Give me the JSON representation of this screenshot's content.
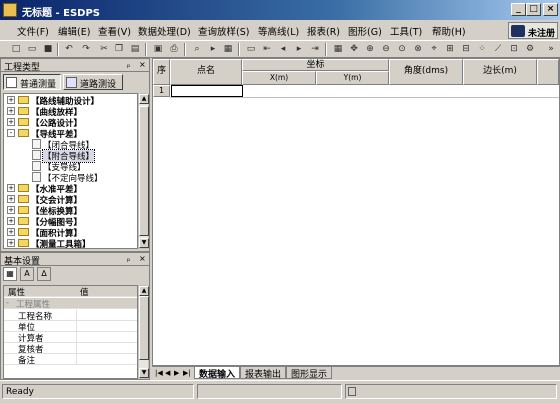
{
  "window": {
    "title": "无标题 - ESDPS"
  },
  "menu": {
    "items": [
      "文件(F)",
      "编辑(E)",
      "查看(V)",
      "数据处理(D)",
      "查询放样(S)",
      "等高线(L)",
      "报表(R)",
      "图形(G)",
      "工具(T)",
      "帮助(H)"
    ]
  },
  "registration": {
    "label": "未注册"
  },
  "left_panel": {
    "title": "工程类型",
    "pin": "ₚ",
    "close": "×",
    "tabs": [
      "普通测量",
      "道路测设"
    ],
    "tree": [
      {
        "level": 0,
        "type": "folder",
        "expander": "+",
        "label": "【路线辅助设计】"
      },
      {
        "level": 0,
        "type": "folder",
        "expander": "+",
        "label": "【曲线放样】"
      },
      {
        "level": 0,
        "type": "folder",
        "expander": "+",
        "label": "【公路设计】"
      },
      {
        "level": 0,
        "type": "folder",
        "expander": "-",
        "label": "【导线平差】"
      },
      {
        "level": 1,
        "type": "doc",
        "label": "【闭合导线】"
      },
      {
        "level": 1,
        "type": "doc",
        "label": "【附合导线】",
        "selected": true
      },
      {
        "level": 1,
        "type": "doc",
        "label": "【支导线】"
      },
      {
        "level": 1,
        "type": "doc",
        "label": "【不定向导线】"
      },
      {
        "level": 0,
        "type": "folder",
        "expander": "+",
        "label": "【水准平差】"
      },
      {
        "level": 0,
        "type": "folder",
        "expander": "+",
        "label": "【交会计算】"
      },
      {
        "level": 0,
        "type": "folder",
        "expander": "+",
        "label": "【坐标换算】"
      },
      {
        "level": 0,
        "type": "folder",
        "expander": "+",
        "label": "【分幅图号】"
      },
      {
        "level": 0,
        "type": "folder",
        "expander": "+",
        "label": "【面积计算】"
      },
      {
        "level": 0,
        "type": "folder",
        "expander": "+",
        "label": "【测量工具箱】"
      }
    ]
  },
  "settings_panel": {
    "title": "基本设置",
    "pin": "ₚ",
    "close": "×",
    "columns": [
      "属性",
      "值"
    ],
    "group": "工程属性",
    "group_expander": "-",
    "rows": [
      "工程名称",
      "单位",
      "计算者",
      "复核者",
      "备注"
    ]
  },
  "grid": {
    "headers": {
      "seq": "序",
      "name": "点名",
      "coord": "坐标",
      "x": "X(m)",
      "y": "Y(m)",
      "angle": "角度(dms)",
      "edge": "边长(m)"
    },
    "rows": [
      {
        "num": "1"
      }
    ]
  },
  "sheet_tabs": {
    "nav": [
      "|◀",
      "◀",
      "▶",
      "▶|"
    ],
    "tabs": [
      "数据输入",
      "报表输出",
      "图形显示"
    ],
    "active": 0
  },
  "status": {
    "text": "Ready"
  },
  "colors": {
    "title_start": "#0a246a",
    "title_end": "#a6caf0",
    "face": "#d4d0c8",
    "folder": "#f2d860"
  }
}
